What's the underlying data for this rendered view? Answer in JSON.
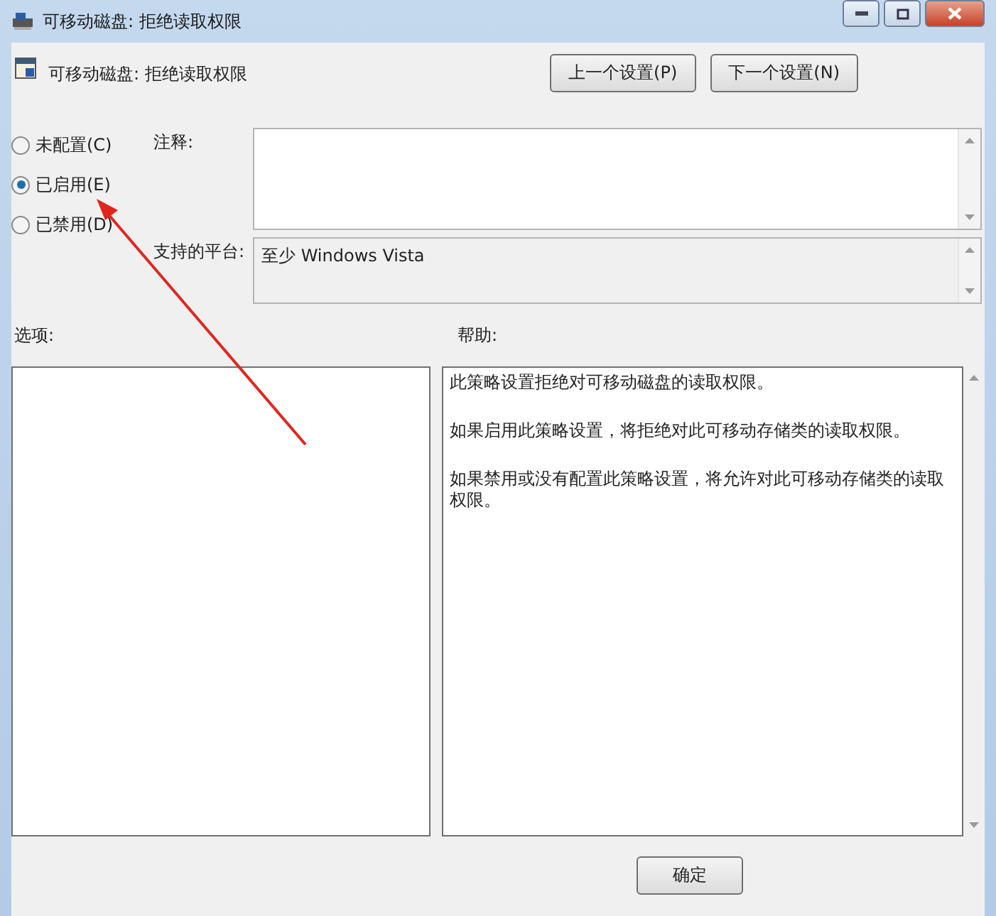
{
  "window": {
    "title": "可移动磁盘: 拒绝读取权限"
  },
  "header": {
    "title": "可移动磁盘: 拒绝读取权限"
  },
  "nav_buttons": [
    {
      "label": "上一个设置(P)"
    },
    {
      "label": "下一个设置(N)"
    }
  ],
  "state_options": [
    {
      "label": "未配置(C)",
      "selected": false
    },
    {
      "label": "已启用(E)",
      "selected": true
    },
    {
      "label": "已禁用(D)",
      "selected": false
    }
  ],
  "comment": {
    "label": "注释:"
  },
  "platform": {
    "label": "支持的平台:",
    "value": "至少 Windows Vista"
  },
  "options": {
    "label": "选项:"
  },
  "help": {
    "label": "帮助:",
    "paragraphs": [
      "此策略设置拒绝对可移动磁盘的读取权限。",
      "如果启用此策略设置，将拒绝对此可移动存储类的读取权限。",
      "如果禁用或没有配置此策略设置，将允许对此可移动存储类的读取权限。"
    ]
  },
  "footer_buttons": [
    {
      "label": "确定"
    }
  ]
}
